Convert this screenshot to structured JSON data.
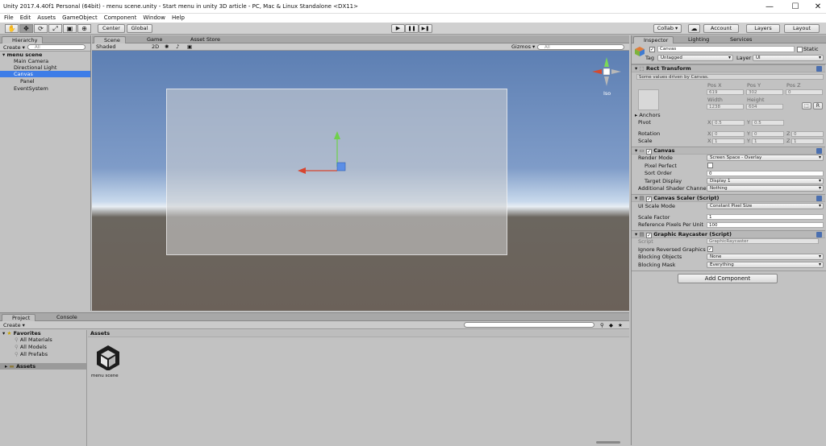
{
  "window": {
    "title": "Unity 2017.4.40f1 Personal (64bit) - menu scene.unity - Start menu in unity 3D article - PC, Mac & Linux Standalone <DX11>",
    "minimize": "—",
    "maximize": "☐",
    "close": "✕"
  },
  "menu": [
    "File",
    "Edit",
    "Assets",
    "GameObject",
    "Component",
    "Window",
    "Help"
  ],
  "toolbar": {
    "pivot_label": "Center",
    "space_label": "Global",
    "play": "▶",
    "pause": "❚❚",
    "step": "▶❚",
    "collab_label": "Collab ▾",
    "cloud": "☁",
    "account_label": "Account",
    "layers_label": "Layers",
    "layout_label": "Layout"
  },
  "hierarchy": {
    "tab": "Hierarchy",
    "create": "Create ▾",
    "search_placeholder": "All",
    "scene_name": "menu scene",
    "items": [
      "Main Camera",
      "Directional Light",
      "Canvas",
      "Panel",
      "EventSystem"
    ],
    "selected": "Canvas"
  },
  "scene": {
    "tabs": [
      "Scene",
      "Game",
      "Asset Store"
    ],
    "shading": "Shaded",
    "mode_2d": "2D",
    "gizmos": "Gizmos ▾",
    "search_placeholder": "All",
    "iso_label": "Iso"
  },
  "project": {
    "tabs": [
      "Project",
      "Console"
    ],
    "create": "Create ▾",
    "favorites_label": "Favorites",
    "favorites": [
      "All Materials",
      "All Models",
      "All Prefabs"
    ],
    "assets_folder": "Assets",
    "assets_header": "Assets",
    "asset_name": "menu scene"
  },
  "inspector": {
    "tabs": [
      "Inspector",
      "Lighting",
      "Services"
    ],
    "object_name": "Canvas",
    "static_label": "Static",
    "tag_label": "Tag",
    "tag_value": "Untagged",
    "layer_label": "Layer",
    "layer_value": "UI",
    "rect_transform": {
      "title": "Rect Transform",
      "note": "Some values driven by Canvas.",
      "pos_x_label": "Pos X",
      "pos_y_label": "Pos Y",
      "pos_z_label": "Pos Z",
      "pos_x": "619",
      "pos_y": "302",
      "pos_z": "0",
      "width_label": "Width",
      "height_label": "Height",
      "width": "1238",
      "height": "604",
      "anchors_label": "Anchors",
      "pivot_label": "Pivot",
      "pivot_x": "0.5",
      "pivot_y": "0.5",
      "rotation_label": "Rotation",
      "rot_x": "0",
      "rot_y": "0",
      "rot_z": "0",
      "scale_label": "Scale",
      "scale_x": "1",
      "scale_y": "1",
      "scale_z": "1",
      "r_button": "R"
    },
    "canvas": {
      "title": "Canvas",
      "render_mode_label": "Render Mode",
      "render_mode": "Screen Space - Overlay",
      "pixel_perfect_label": "Pixel Perfect",
      "sort_order_label": "Sort Order",
      "sort_order": "0",
      "target_display_label": "Target Display",
      "target_display": "Display 1",
      "shader_channels_label": "Additional Shader Channels",
      "shader_channels": "Nothing"
    },
    "canvas_scaler": {
      "title": "Canvas Scaler (Script)",
      "ui_scale_mode_label": "UI Scale Mode",
      "ui_scale_mode": "Constant Pixel Size",
      "scale_factor_label": "Scale Factor",
      "scale_factor": "1",
      "ref_ppu_label": "Reference Pixels Per Unit",
      "ref_ppu": "100"
    },
    "graphic_raycaster": {
      "title": "Graphic Raycaster (Script)",
      "script_label": "Script",
      "script_value": "GraphicRaycaster",
      "ignore_reversed_label": "Ignore Reversed Graphics",
      "blocking_objects_label": "Blocking Objects",
      "blocking_objects": "None",
      "blocking_mask_label": "Blocking Mask",
      "blocking_mask": "Everything"
    },
    "add_component": "Add Component"
  },
  "colors": {
    "selection": "#3e7de7",
    "panel": "#c2c2c2",
    "tab_strip": "#a8a8a8"
  }
}
